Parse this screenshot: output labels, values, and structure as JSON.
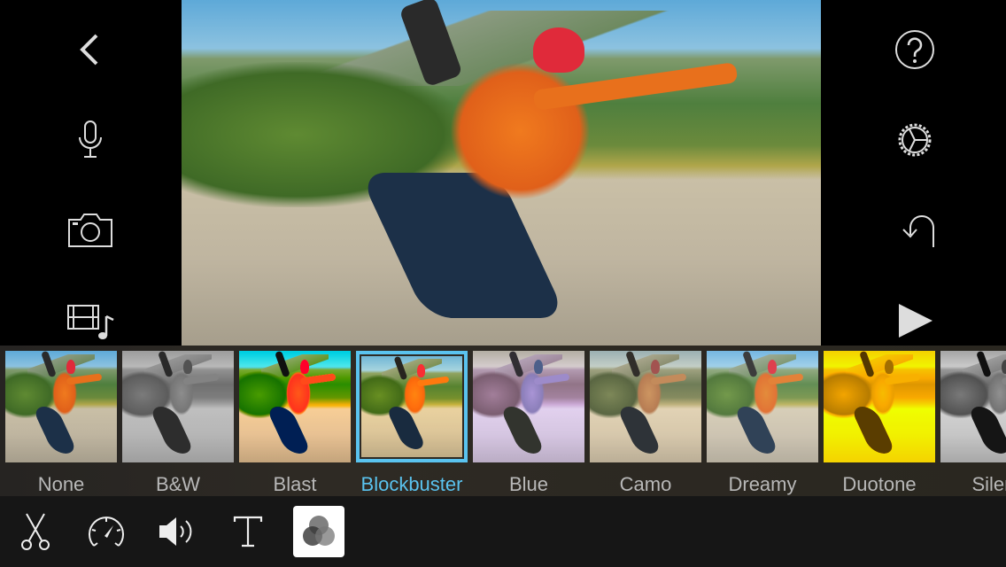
{
  "left_sidebar": {
    "icons": [
      "back-chevron-icon",
      "microphone-icon",
      "camera-icon",
      "media-library-icon"
    ]
  },
  "right_sidebar": {
    "icons": [
      "help-icon",
      "settings-gear-icon",
      "undo-icon",
      "play-icon"
    ]
  },
  "filters": {
    "selected": "Blockbuster",
    "accent": "#5ac3ef",
    "items": [
      {
        "label": "None"
      },
      {
        "label": "B&W"
      },
      {
        "label": "Blast"
      },
      {
        "label": "Blockbuster"
      },
      {
        "label": "Blue"
      },
      {
        "label": "Camo"
      },
      {
        "label": "Dreamy"
      },
      {
        "label": "Duotone"
      },
      {
        "label": "Silent"
      }
    ]
  },
  "toolbar": {
    "tools": [
      "scissors-icon",
      "speed-icon",
      "volume-icon",
      "title-text-icon",
      "filters-icon"
    ],
    "active": "filters-icon"
  }
}
